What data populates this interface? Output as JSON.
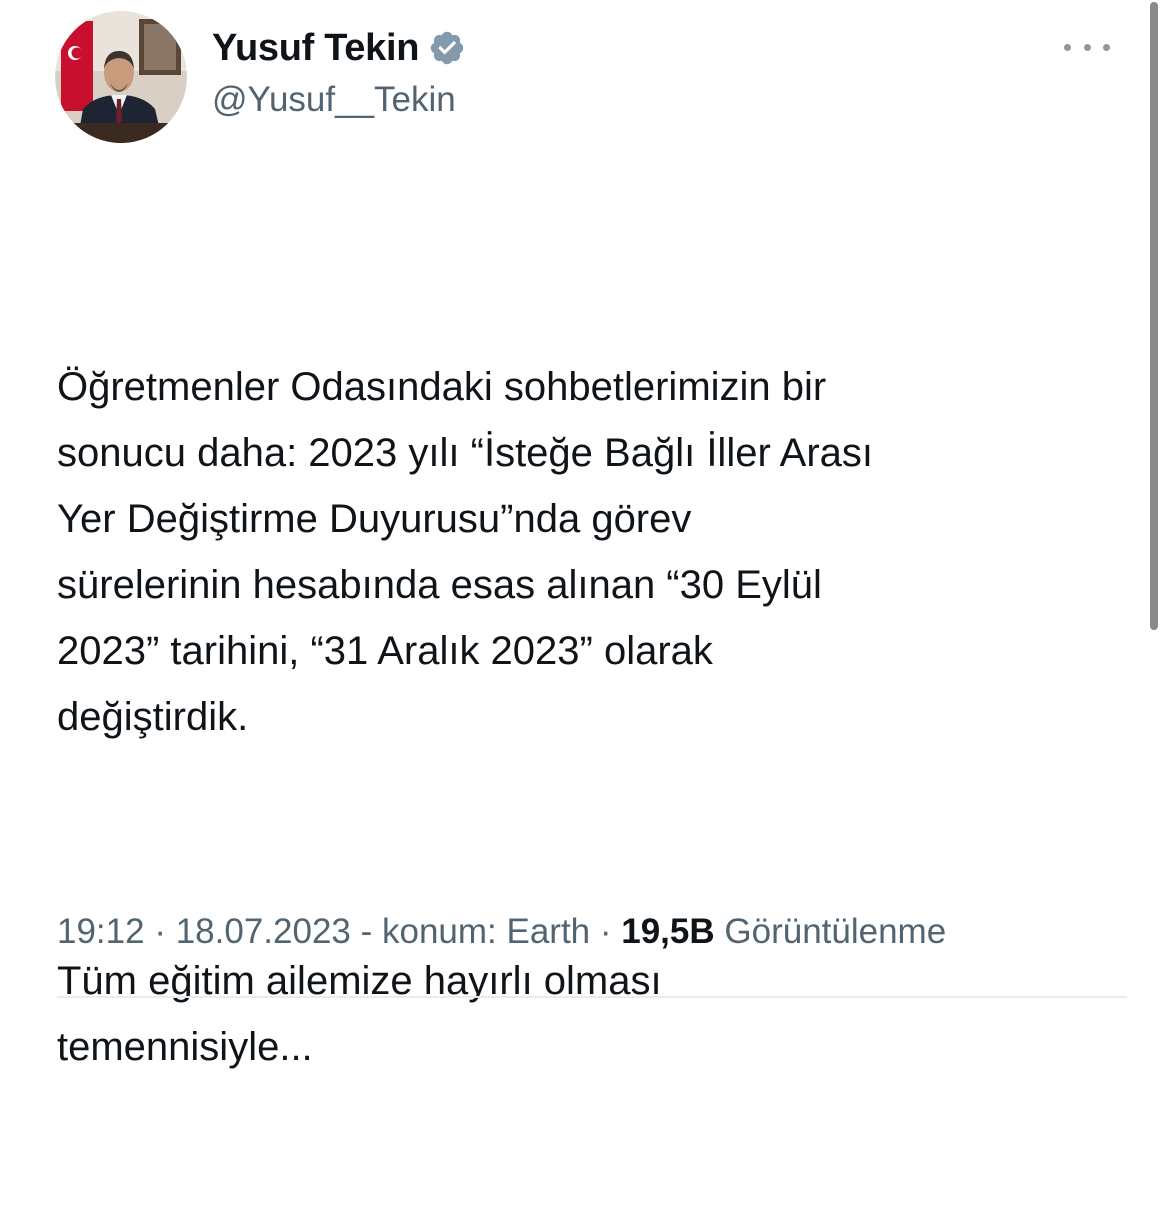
{
  "author": {
    "display_name": "Yusuf Tekin",
    "handle": "@Yusuf__Tekin",
    "verified": true,
    "verified_icon": "verified-badge-icon",
    "verified_color": "#829aab"
  },
  "tweet": {
    "paragraphs": [
      "Öğretmenler Odasındaki sohbetlerimizin bir\nsonucu daha: 2023 yılı “İsteğe Bağlı İller Arası\nYer Değiştirme Duyurusu”nda görev\nsürelerinin hesabında esas alınan “30 Eylül\n2023” tarihini, “31 Aralık 2023” olarak\ndeğiştirdik.",
      "Tüm eğitim ailemize hayırlı olması\ntemennisiyle..."
    ]
  },
  "meta": {
    "time": "19:12",
    "sep1": " · ",
    "date": "18.07.2023",
    "sep2": " - ",
    "location": "konum: Earth",
    "sep3": " · ",
    "views_count": "19,5B",
    "views_label": " Görüntülenme"
  },
  "more_menu_icon": "more-options-icon"
}
